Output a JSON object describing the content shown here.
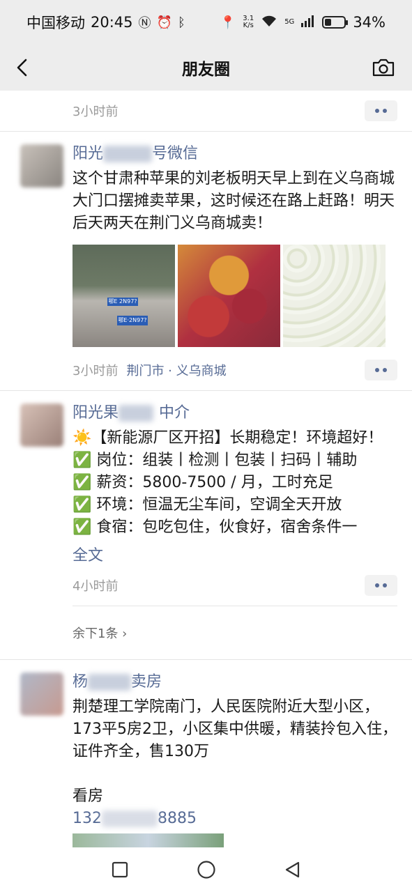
{
  "status_bar": {
    "carrier": "中国移动",
    "time": "20:45",
    "net_speed_value": "3.1",
    "net_speed_unit": "K/s",
    "network": "5G",
    "battery": "34%",
    "battery_level": 0.34
  },
  "nav": {
    "title": "朋友圈"
  },
  "top_partial": {
    "time": "3小时前"
  },
  "posts": [
    {
      "name_visible_start": "阳光",
      "name_visible_end": "号微信",
      "content": "这个甘肃种苹果的刘老板明天早上到在义乌商城大门口摆摊卖苹果，这时候还在路上赶路！明天后天两天在荆门义乌商城卖！",
      "photo_plate_1": "鄂E 2N97?",
      "photo_plate_2": "鄂E·2N97?",
      "time": "3小时前",
      "location": "荆门市 · 义乌商城"
    },
    {
      "name_visible_start": "阳光果",
      "name_visible_end": "中介",
      "lines": [
        "☀️【新能源厂区开招】长期稳定！环境超好！",
        "✅ 岗位：组装丨检测丨包装丨扫码丨辅助",
        "✅ 薪资：5800-7500 / 月，工时充足",
        "✅ 环境：恒温无尘车间，空调全天开放",
        "✅ 食宿：包吃包住，伙食好，宿舍条件一"
      ],
      "full_text_link": "全文",
      "time": "4小时前"
    },
    {
      "name_visible_start": "杨",
      "name_visible_end": "卖房",
      "content_line1": "荆楚理工学院南门，人民医院附近大型小区，173平5房2卫，小区集中供暖，精装拎包入住，证件齐全，售130万",
      "content_prefix": "看房",
      "phone_start": "132",
      "phone_end": "8885"
    }
  ],
  "collapsed": {
    "label": "余下1条 ›"
  }
}
